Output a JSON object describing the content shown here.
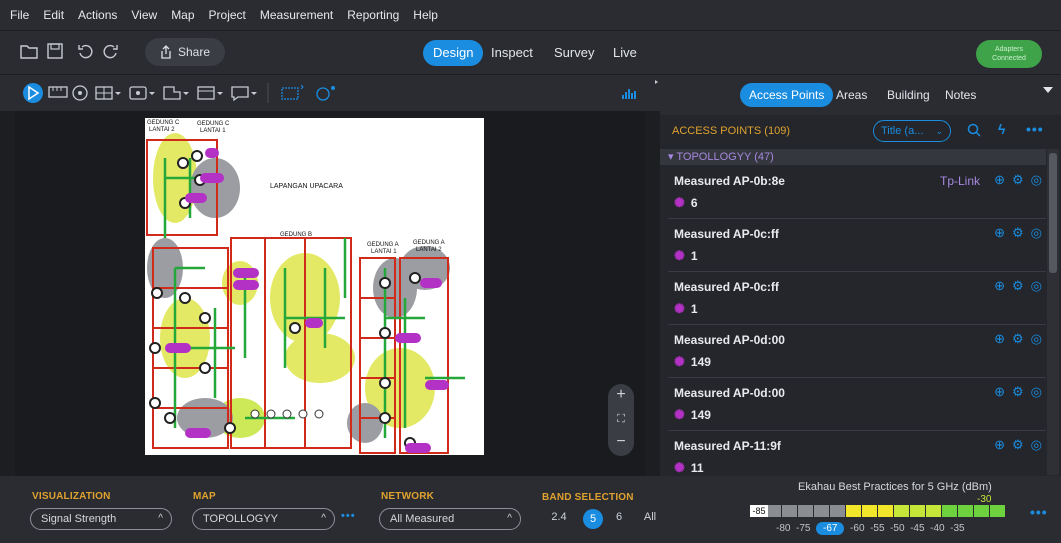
{
  "menu": [
    "File",
    "Edit",
    "Actions",
    "View",
    "Map",
    "Project",
    "Measurement",
    "Reporting",
    "Help"
  ],
  "toolbar": {
    "share_label": "Share",
    "modes": [
      "Design",
      "Inspect",
      "Survey",
      "Live"
    ],
    "active_mode": "Design",
    "adapters_line1": "Adapters",
    "adapters_line2": "Connected"
  },
  "right_panel": {
    "tabs": [
      "Access Points",
      "Areas",
      "Building",
      "Notes"
    ],
    "active_tab": "Access Points",
    "header_title": "ACCESS POINTS (109)",
    "sort_select": "Title (a...",
    "group_label": "TOPOLLOGYY (47)",
    "access_points": [
      {
        "name": "Measured AP-0b:8e",
        "vendor": "Tp-Link",
        "channel": "6"
      },
      {
        "name": "Measured AP-0c:ff",
        "vendor": "",
        "channel": "1"
      },
      {
        "name": "Measured AP-0c:ff",
        "vendor": "",
        "channel": "1"
      },
      {
        "name": "Measured AP-0d:00",
        "vendor": "",
        "channel": "149"
      },
      {
        "name": "Measured AP-0d:00",
        "vendor": "",
        "channel": "149"
      },
      {
        "name": "Measured AP-11:9f",
        "vendor": "",
        "channel": "11"
      }
    ]
  },
  "map": {
    "labels": {
      "gedung_c2": "GEDUNG C",
      "lantai2": "LANTAI 2",
      "gedung_c1": "GEDUNG C",
      "lantai1": "LANTAI 1",
      "lapangan": "LAPANGAN UPACARA",
      "gedung_b": "GEDUNG B",
      "gedung_a1": "GEDUNG A",
      "lantai_a1": "LANTAI 1",
      "gedung_a2": "GEDUNG A",
      "lantai_a2": "LANTAI 2"
    }
  },
  "bottom": {
    "visualization_label": "VISUALIZATION",
    "visualization_value": "Signal Strength",
    "map_label": "MAP",
    "map_value": "TOPOLLOGYY",
    "network_label": "NETWORK",
    "network_value": "All Measured",
    "band_label": "BAND SELECTION",
    "bands": [
      "2.4",
      "5",
      "6",
      "All"
    ],
    "active_band": "5"
  },
  "legend": {
    "title": "Ekahau Best Practices for 5 GHz (dBm)",
    "min_label": "-85",
    "max_label": "-30",
    "ticks": [
      "-80",
      "-75",
      "-67",
      "-60",
      "-55",
      "-50",
      "-45",
      "-40",
      "-35"
    ],
    "selected_tick": "-67",
    "colors": {
      "gray": "#8a8d92",
      "yellow": "#f2e62a",
      "lime": "#c6e63a",
      "green": "#6ed13e"
    }
  },
  "colors": {
    "accent": "#1a8de0",
    "group_purple": "#a688e0",
    "label_orange": "#e0a22f"
  }
}
